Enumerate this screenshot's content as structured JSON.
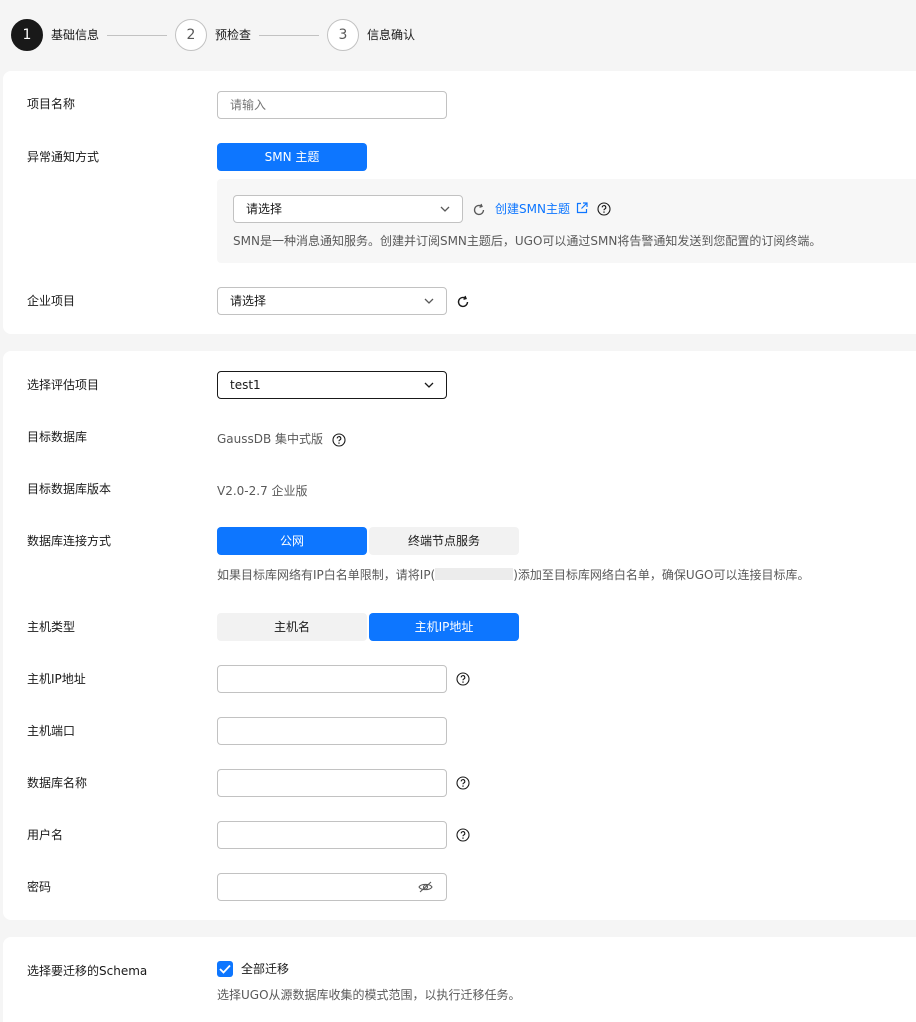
{
  "steps": [
    {
      "num": "1",
      "label": "基础信息"
    },
    {
      "num": "2",
      "label": "预检查"
    },
    {
      "num": "3",
      "label": "信息确认"
    }
  ],
  "basic": {
    "project_name_label": "项目名称",
    "project_name_placeholder": "请输入",
    "notify_label": "异常通知方式",
    "smn_button": "SMN 主题",
    "smn_select_placeholder": "请选择",
    "create_smn_link": "创建SMN主题",
    "smn_hint": "SMN是一种消息通知服务。创建并订阅SMN主题后，UGO可以通过SMN将告警通知发送到您配置的订阅终端。",
    "enterprise_label": "企业项目",
    "enterprise_placeholder": "请选择"
  },
  "db": {
    "eval_label": "选择评估项目",
    "eval_value": "test1",
    "target_db_label": "目标数据库",
    "target_db_value": "GaussDB 集中式版",
    "target_ver_label": "目标数据库版本",
    "target_ver_value": "V2.0-2.7 企业版",
    "conn_label": "数据库连接方式",
    "conn_options": [
      "公网",
      "终端节点服务"
    ],
    "conn_hint_before": "如果目标库网络有IP白名单限制，请将IP(",
    "conn_hint_after": ")添加至目标库网络白名单，确保UGO可以连接目标库。",
    "host_type_label": "主机类型",
    "host_type_options": [
      "主机名",
      "主机IP地址"
    ],
    "host_ip_label": "主机IP地址",
    "host_port_label": "主机端口",
    "db_name_label": "数据库名称",
    "username_label": "用户名",
    "password_label": "密码"
  },
  "schema": {
    "label": "选择要迁移的Schema",
    "checkbox_label": "全部迁移",
    "checked": true,
    "hint": "选择UGO从源数据库收集的模式范围，以执行迁移任务。"
  },
  "colors": {
    "primary": "#0d76ff",
    "text": "#191919",
    "secondary": "#595959",
    "border": "#c2c2c2"
  }
}
